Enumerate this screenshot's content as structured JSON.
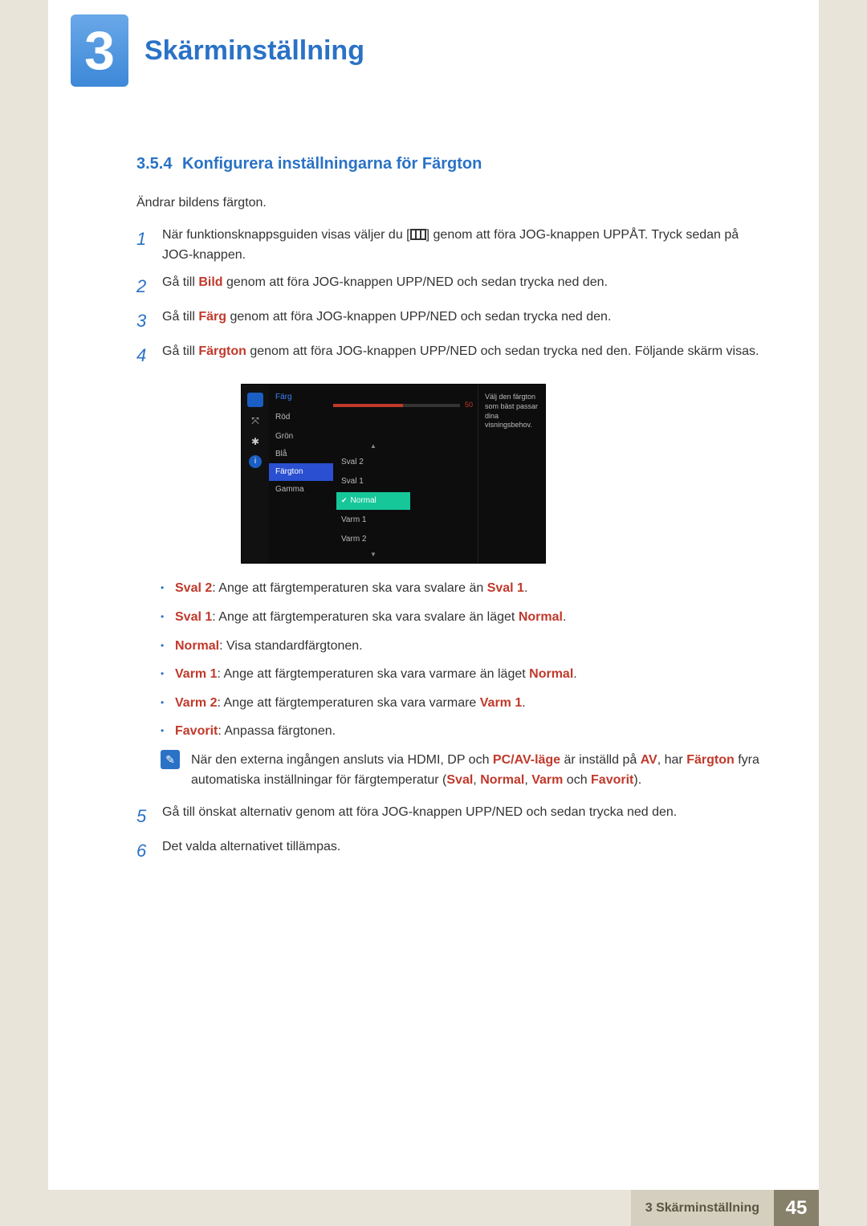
{
  "chapter": {
    "number": "3",
    "title": "Skärminställning"
  },
  "section": {
    "number": "3.5.4",
    "title": "Konfigurera inställningarna för Färgton"
  },
  "intro": "Ändrar bildens färgton.",
  "steps": [
    {
      "n": "1",
      "pre": "När funktionsknappsguiden visas väljer du [",
      "post": "] genom att föra JOG-knappen UPPÅT. Tryck sedan på JOG-knappen."
    },
    {
      "n": "2",
      "prefix": "Gå till ",
      "bold": "Bild",
      "rest": " genom att föra JOG-knappen UPP/NED och sedan trycka ned den."
    },
    {
      "n": "3",
      "prefix": "Gå till ",
      "bold": "Färg",
      "rest": " genom att föra JOG-knappen UPP/NED och sedan trycka ned den."
    },
    {
      "n": "4",
      "prefix": "Gå till ",
      "bold": "Färgton",
      "rest": " genom att föra JOG-knappen UPP/NED och sedan trycka ned den. Följande skärm visas."
    }
  ],
  "osd": {
    "header": "Färg",
    "menu": [
      "Röd",
      "Grön",
      "Blå",
      "Färgton",
      "Gamma"
    ],
    "selected": "Färgton",
    "slider_value": "50",
    "options_above": [
      "Sval 2",
      "Sval 1"
    ],
    "option_checked": "Normal",
    "options_below": [
      "Varm 1",
      "Varm 2"
    ],
    "help": "Välj den färgton som bäst passar dina visningsbehov."
  },
  "bullets": [
    {
      "b": "Sval 2",
      "mid": ": Ange att färgtemperaturen ska vara svalare än ",
      "b2": "Sval 1",
      "tail": "."
    },
    {
      "b": "Sval 1",
      "mid": ": Ange att färgtemperaturen ska vara svalare än läget ",
      "b2": "Normal",
      "tail": "."
    },
    {
      "b": "Normal",
      "mid": ": Visa standardfärgtonen.",
      "b2": "",
      "tail": ""
    },
    {
      "b": "Varm 1",
      "mid": ": Ange att färgtemperaturen ska vara varmare än läget ",
      "b2": "Normal",
      "tail": "."
    },
    {
      "b": "Varm 2",
      "mid": ": Ange att färgtemperaturen ska vara varmare ",
      "b2": "Varm 1",
      "tail": "."
    },
    {
      "b": "Favorit",
      "mid": ": Anpassa färgtonen.",
      "b2": "",
      "tail": ""
    }
  ],
  "note": {
    "p1a": "När den externa ingången ansluts via HDMI, DP och ",
    "b1": "PC/AV-läge",
    "p1b": " är inställd på ",
    "b2": "AV",
    "p1c": ", har ",
    "b3": "Färgton",
    "p2a": " fyra automatiska inställningar för färgtemperatur (",
    "b4": "Sval",
    "c1": ", ",
    "b5": "Normal",
    "c2": ", ",
    "b6": "Varm",
    "c3": " och ",
    "b7": "Favorit",
    "p2b": ")."
  },
  "step5": {
    "n": "5",
    "text": "Gå till önskat alternativ genom att föra JOG-knappen UPP/NED och sedan trycka ned den."
  },
  "step6": {
    "n": "6",
    "text": "Det valda alternativet tillämpas."
  },
  "footer": {
    "label": "3 Skärminställning",
    "page": "45"
  }
}
